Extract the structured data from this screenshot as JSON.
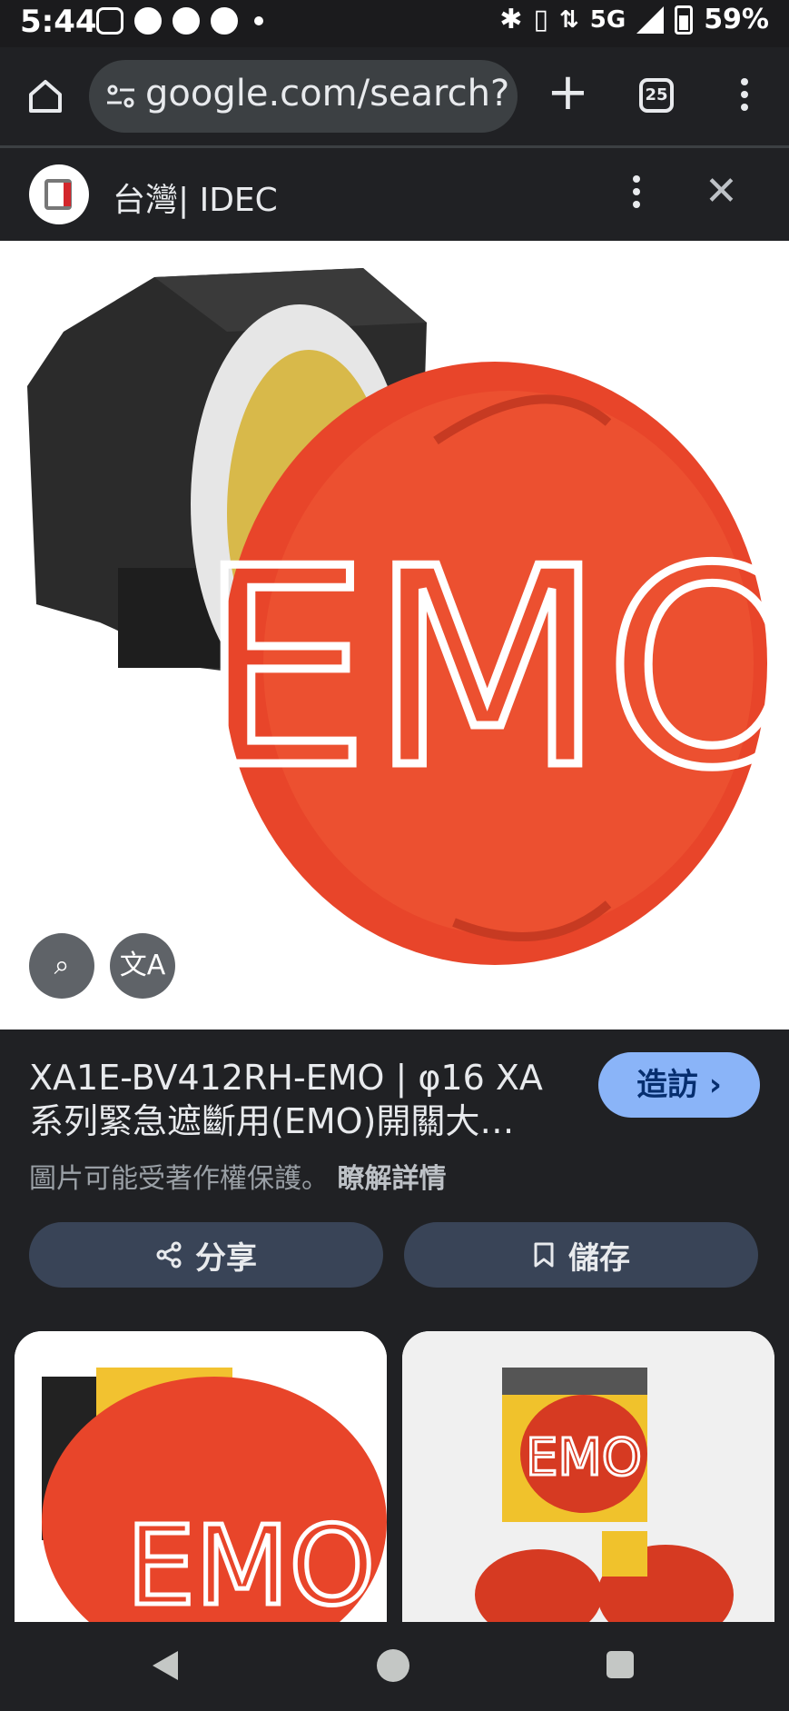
{
  "status_bar": {
    "time": "5:44",
    "network": "5G",
    "battery": "59%",
    "icons": [
      "instagram-icon",
      "line-icon",
      "facebook-icon",
      "fire-icon",
      "dot-icon",
      "bluetooth-icon",
      "vibrate-icon",
      "volte-icon",
      "signal-icon",
      "battery-icon"
    ]
  },
  "browser": {
    "url": "google.com/search?c",
    "tab_count": "25"
  },
  "source": {
    "title": "台灣| IDEC"
  },
  "main_image": {
    "product_text": "EMO"
  },
  "info": {
    "title": "XA1E-BV412RH-EMO | φ16 XA 系列緊急遮斷用(EMO)開關大…",
    "visit_label": "造訪",
    "copyright": "圖片可能受著作權保護。",
    "learn_more": "瞭解詳情"
  },
  "actions": {
    "share_label": "分享",
    "save_label": "儲存"
  },
  "related": {
    "thumb1_text": "EMO",
    "thumb2_text": "EMO"
  },
  "colors": {
    "background": "#202124",
    "accent": "#8ab4f8",
    "pill": "#394457",
    "emo_red": "#e8452a"
  }
}
